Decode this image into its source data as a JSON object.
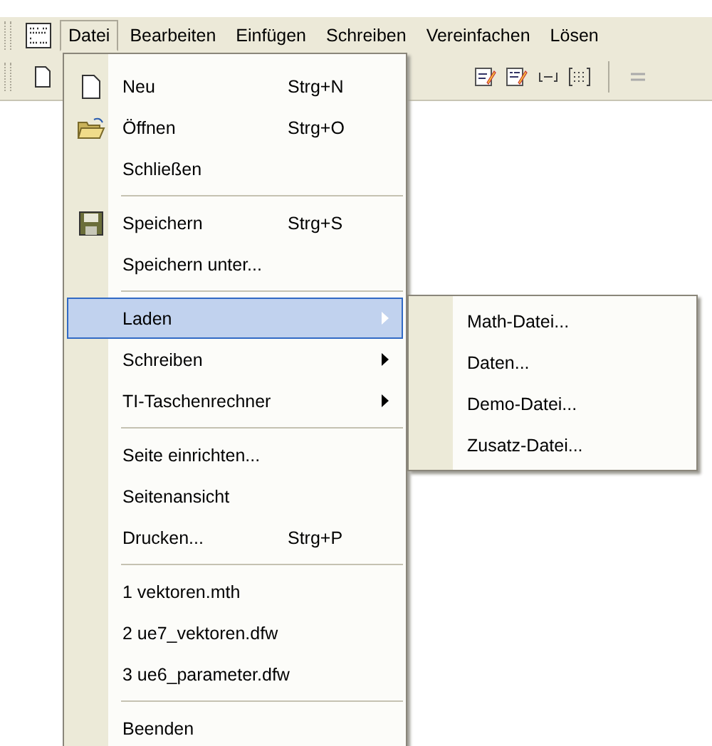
{
  "menubar": {
    "items": [
      {
        "label": "Datei",
        "selected": true
      },
      {
        "label": "Bearbeiten",
        "selected": false
      },
      {
        "label": "Einfügen",
        "selected": false
      },
      {
        "label": "Schreiben",
        "selected": false
      },
      {
        "label": "Vereinfachen",
        "selected": false
      },
      {
        "label": "Lösen",
        "selected": false
      }
    ]
  },
  "menu": {
    "items": [
      {
        "kind": "item",
        "label": "Neu",
        "shortcut": "Strg+N",
        "selected": false
      },
      {
        "kind": "item",
        "label": "Öffnen",
        "shortcut": "Strg+O",
        "selected": false
      },
      {
        "kind": "item",
        "label": "Schließen",
        "selected": false
      },
      {
        "kind": "separator"
      },
      {
        "kind": "item",
        "label": "Speichern",
        "shortcut": "Strg+S",
        "selected": false
      },
      {
        "kind": "item",
        "label": "Speichern unter...",
        "selected": false
      },
      {
        "kind": "separator"
      },
      {
        "kind": "submenu",
        "label": "Laden",
        "selected": true
      },
      {
        "kind": "submenu",
        "label": "Schreiben",
        "selected": false
      },
      {
        "kind": "submenu",
        "label": "TI-Taschenrechner",
        "selected": false
      },
      {
        "kind": "separator"
      },
      {
        "kind": "item",
        "label": "Seite einrichten...",
        "selected": false
      },
      {
        "kind": "item",
        "label": "Seitenansicht",
        "selected": false
      },
      {
        "kind": "item",
        "label": "Drucken...",
        "shortcut": "Strg+P",
        "selected": false
      },
      {
        "kind": "separator"
      },
      {
        "kind": "item",
        "label": "1 vektoren.mth",
        "selected": false
      },
      {
        "kind": "item",
        "label": "2 ue7_vektoren.dfw",
        "selected": false
      },
      {
        "kind": "item",
        "label": "3 ue6_parameter.dfw",
        "selected": false
      },
      {
        "kind": "separator"
      },
      {
        "kind": "item",
        "label": "Beenden",
        "selected": false
      }
    ]
  },
  "submenu": {
    "items": [
      {
        "label": "Math-Datei...",
        "selected": false
      },
      {
        "label": "Daten...",
        "selected": false
      },
      {
        "label": "Demo-Datei...",
        "selected": false
      },
      {
        "label": "Zusatz-Datei...",
        "selected": false
      }
    ]
  }
}
